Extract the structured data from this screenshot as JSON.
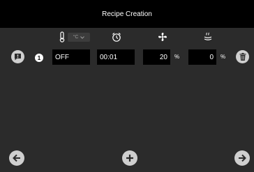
{
  "title": "Recipe Creation",
  "header": {
    "unit_select": "°C",
    "icons": [
      "thermometer-icon",
      "alarm-clock-icon",
      "fan-icon",
      "steam-icon"
    ]
  },
  "step": {
    "number": "1",
    "status": "OFF",
    "time": "00:01",
    "fan_value": "20",
    "fan_unit": "%",
    "steam_value": "0",
    "steam_unit": "%"
  },
  "colors": {
    "background": "#2b2b2b",
    "titlebar": "#000000",
    "button": "#cfcfcf"
  }
}
